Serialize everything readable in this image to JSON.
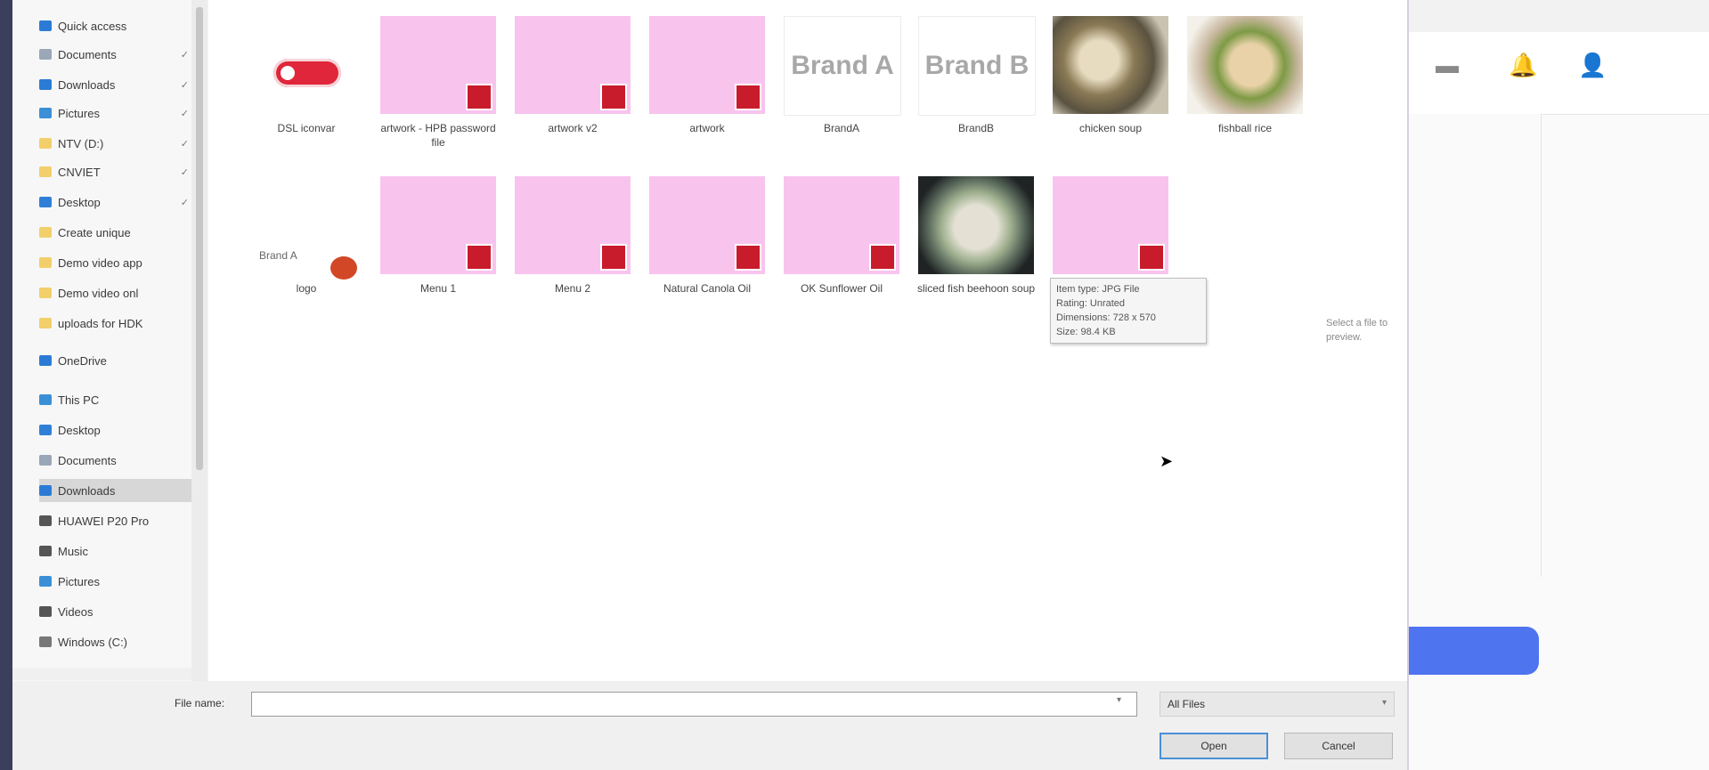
{
  "nav": {
    "items": [
      {
        "label": "Quick access",
        "icon": "star-icon",
        "pinned": false
      },
      {
        "label": "Documents",
        "icon": "documents-icon",
        "pinned": true
      },
      {
        "label": "Downloads",
        "icon": "download-icon",
        "pinned": true
      },
      {
        "label": "Pictures",
        "icon": "pictures-icon",
        "pinned": true
      },
      {
        "label": "NTV (D:)",
        "icon": "folder-icon",
        "pinned": true
      },
      {
        "label": "CNVIET",
        "icon": "folder-icon",
        "pinned": true
      },
      {
        "label": "Desktop",
        "icon": "desktop-icon",
        "pinned": true
      },
      {
        "label": "Create unique",
        "icon": "folder-icon",
        "pinned": false
      },
      {
        "label": "Demo video app",
        "icon": "folder-icon",
        "pinned": false
      },
      {
        "label": "Demo video onl",
        "icon": "folder-icon",
        "pinned": false
      },
      {
        "label": "uploads for HDK",
        "icon": "folder-icon",
        "pinned": false
      },
      {
        "label": "OneDrive",
        "icon": "cloud-icon",
        "pinned": false
      },
      {
        "label": "This PC",
        "icon": "computer-icon",
        "pinned": false
      },
      {
        "label": "Desktop",
        "icon": "desktop-icon",
        "pinned": false
      },
      {
        "label": "Documents",
        "icon": "documents-icon",
        "pinned": false
      },
      {
        "label": "Downloads",
        "icon": "download-icon",
        "pinned": false,
        "selected": true
      },
      {
        "label": "HUAWEI P20 Pro",
        "icon": "phone-icon",
        "pinned": false
      },
      {
        "label": "Music",
        "icon": "music-icon",
        "pinned": false
      },
      {
        "label": "Pictures",
        "icon": "pictures-icon",
        "pinned": false
      },
      {
        "label": "Videos",
        "icon": "videos-icon",
        "pinned": false
      },
      {
        "label": "Windows (C:)",
        "icon": "drive-icon",
        "pinned": false
      }
    ],
    "pin_glyph": "✓"
  },
  "files": [
    {
      "label": "DSL iconvar",
      "kind": "toggle"
    },
    {
      "label": "artwork - HPB password file",
      "kind": "pdf"
    },
    {
      "label": "artwork v2",
      "kind": "pdf"
    },
    {
      "label": "artwork",
      "kind": "pdf"
    },
    {
      "label": "BrandA",
      "kind": "brand",
      "brand_text": "Brand A"
    },
    {
      "label": "BrandB",
      "kind": "brand",
      "brand_text": "Brand B"
    },
    {
      "label": "chicken soup",
      "kind": "food1"
    },
    {
      "label": "fishball rice",
      "kind": "food2"
    },
    {
      "label": "logo",
      "kind": "logo",
      "small_text": "Brand A"
    },
    {
      "label": "Menu 1",
      "kind": "pdf"
    },
    {
      "label": "Menu 2",
      "kind": "pdf"
    },
    {
      "label": "Natural Canola Oil",
      "kind": "pdf"
    },
    {
      "label": "OK Sunflower Oil",
      "kind": "pdf"
    },
    {
      "label": "sliced fish beehoon soup",
      "kind": "food3"
    },
    {
      "label": "",
      "kind": "pdf"
    }
  ],
  "tooltip": {
    "lines": [
      "Item type: JPG File",
      "Rating: Unrated",
      "Dimensions: 728 x 570",
      "Size: 98.4 KB"
    ]
  },
  "preview_hint": "Select a file to preview.",
  "footer": {
    "file_name_label": "File name:",
    "file_name_value": "",
    "file_type": "All Files",
    "open_label": "Open",
    "cancel_label": "Cancel"
  },
  "background_app": {
    "icons": [
      "chat-icon",
      "bell-icon",
      "user-icon"
    ]
  },
  "colors": {
    "pdf_badge": "#c81c2c",
    "pink_thumb": "#f8c4ee",
    "accent_blue": "#4f74f0"
  }
}
